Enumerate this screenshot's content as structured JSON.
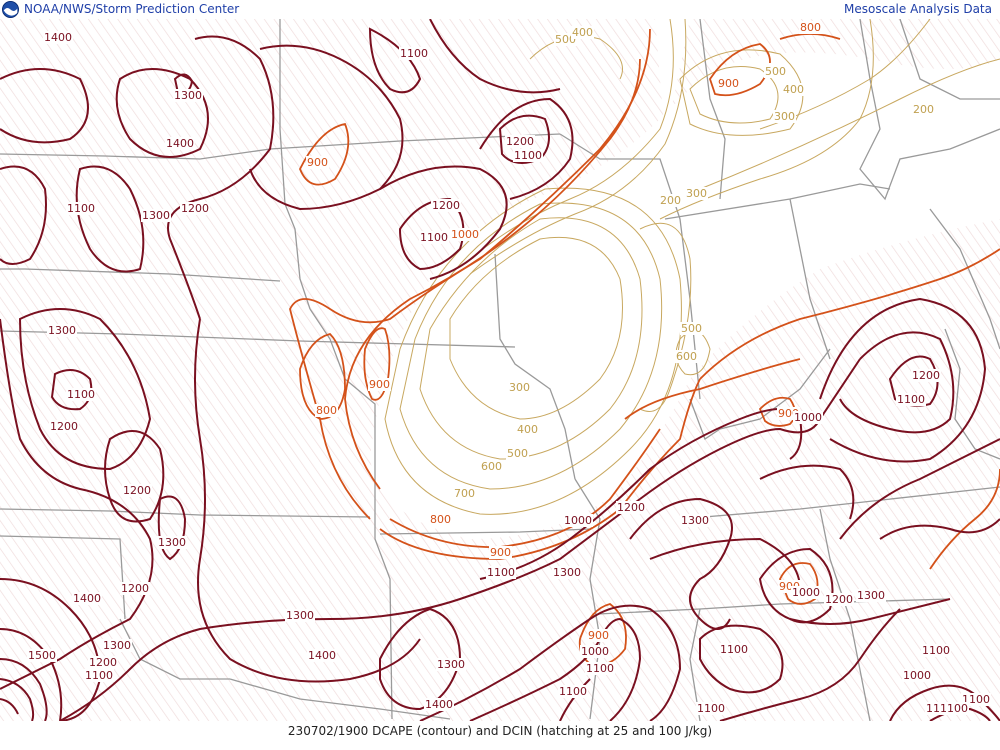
{
  "header": {
    "agency": "NOAA/NWS/Storm Prediction Center",
    "product": "Mesoscale Analysis Data"
  },
  "footer": {
    "caption": "230702/1900 DCAPE (contour) and DCIN (hatching at 25 and 100 J/kg)"
  },
  "icons": [
    "noaa-logo-icon"
  ],
  "colors": {
    "dcape_high": "#7a1020",
    "dcape_mid": "#d4521a",
    "dcape_low": "#c0a050",
    "borders": "#9a9a9a",
    "hatching": "#f0dcdc"
  },
  "contour_labels": [
    {
      "t": "1400",
      "c": "high"
    },
    {
      "t": "1100",
      "c": "high"
    },
    {
      "t": "1300",
      "c": "high"
    },
    {
      "t": "1400",
      "c": "high"
    },
    {
      "t": "1200",
      "c": "high"
    },
    {
      "t": "1100",
      "c": "high"
    },
    {
      "t": "900",
      "c": "mid"
    },
    {
      "t": "1300",
      "c": "high"
    },
    {
      "t": "1200",
      "c": "high"
    },
    {
      "t": "1100",
      "c": "high"
    },
    {
      "t": "1200",
      "c": "high"
    },
    {
      "t": "1100",
      "c": "high"
    },
    {
      "t": "1000",
      "c": "mid"
    },
    {
      "t": "500",
      "c": "low"
    },
    {
      "t": "400",
      "c": "low"
    },
    {
      "t": "800",
      "c": "mid"
    },
    {
      "t": "900",
      "c": "mid"
    },
    {
      "t": "600",
      "c": "low"
    },
    {
      "t": "500",
      "c": "low"
    },
    {
      "t": "400",
      "c": "low"
    },
    {
      "t": "300",
      "c": "low"
    },
    {
      "t": "200",
      "c": "low"
    },
    {
      "t": "200",
      "c": "low"
    },
    {
      "t": "300",
      "c": "low"
    },
    {
      "t": "1300",
      "c": "high"
    },
    {
      "t": "1100",
      "c": "high"
    },
    {
      "t": "1200",
      "c": "high"
    },
    {
      "t": "900",
      "c": "mid"
    },
    {
      "t": "800",
      "c": "mid"
    },
    {
      "t": "300",
      "c": "low"
    },
    {
      "t": "400",
      "c": "low"
    },
    {
      "t": "500",
      "c": "low"
    },
    {
      "t": "600",
      "c": "low"
    },
    {
      "t": "700",
      "c": "low"
    },
    {
      "t": "800",
      "c": "mid"
    },
    {
      "t": "500",
      "c": "low"
    },
    {
      "t": "600",
      "c": "low"
    },
    {
      "t": "1200",
      "c": "high"
    },
    {
      "t": "1100",
      "c": "high"
    },
    {
      "t": "900",
      "c": "mid"
    },
    {
      "t": "1000",
      "c": "high"
    },
    {
      "t": "1200",
      "c": "high"
    },
    {
      "t": "1300",
      "c": "high"
    },
    {
      "t": "1000",
      "c": "high"
    },
    {
      "t": "900",
      "c": "mid"
    },
    {
      "t": "1100",
      "c": "high"
    },
    {
      "t": "1300",
      "c": "high"
    },
    {
      "t": "1200",
      "c": "high"
    },
    {
      "t": "1300",
      "c": "high"
    },
    {
      "t": "1400",
      "c": "high"
    },
    {
      "t": "1300",
      "c": "high"
    },
    {
      "t": "1500",
      "c": "high"
    },
    {
      "t": "1200",
      "c": "high"
    },
    {
      "t": "1100",
      "c": "high"
    },
    {
      "t": "1400",
      "c": "high"
    },
    {
      "t": "1300",
      "c": "high"
    },
    {
      "t": "1400",
      "c": "high"
    },
    {
      "t": "1100",
      "c": "high"
    },
    {
      "t": "900",
      "c": "mid"
    },
    {
      "t": "1000",
      "c": "high"
    },
    {
      "t": "1100",
      "c": "high"
    },
    {
      "t": "1100",
      "c": "high"
    },
    {
      "t": "1100",
      "c": "high"
    },
    {
      "t": "900",
      "c": "mid"
    },
    {
      "t": "1000",
      "c": "high"
    },
    {
      "t": "1200",
      "c": "high"
    },
    {
      "t": "1300",
      "c": "high"
    },
    {
      "t": "1100",
      "c": "high"
    },
    {
      "t": "1000",
      "c": "high"
    },
    {
      "t": "1100",
      "c": "high"
    },
    {
      "t": "1100",
      "c": "high"
    },
    {
      "t": "1300",
      "c": "high"
    },
    {
      "t": "1200",
      "c": "high"
    },
    {
      "t": "1100",
      "c": "high"
    },
    {
      "t": "1300",
      "c": "high"
    }
  ]
}
